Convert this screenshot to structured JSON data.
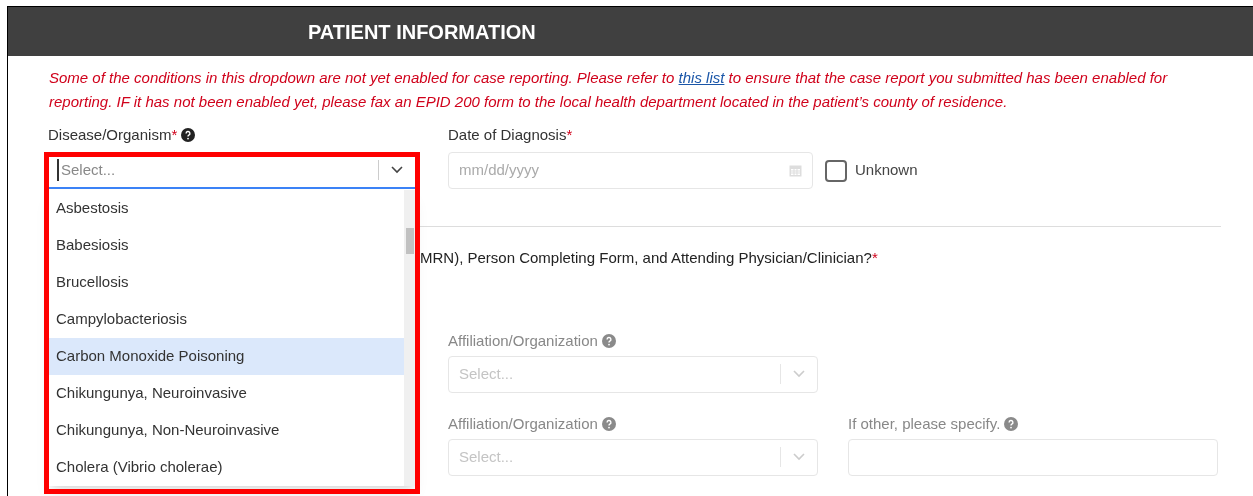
{
  "header": {
    "title": "PATIENT INFORMATION"
  },
  "notice": {
    "before": "Some of the conditions in this dropdown are not yet enabled for case reporting. Please refer to",
    "link": "this list",
    "after": "to ensure that the case report you submitted has been enabled for reporting. IF it has not been enabled yet, please fax an EPID 200 form to the local health department located in the patient’s county of residence."
  },
  "disease": {
    "label": "Disease/Organism",
    "required": "*",
    "placeholder": "Select...",
    "options": [
      {
        "label": "Asbestosis",
        "selected": false
      },
      {
        "label": "Babesiosis",
        "selected": false
      },
      {
        "label": "Brucellosis",
        "selected": false
      },
      {
        "label": "Campylobacteriosis",
        "selected": false
      },
      {
        "label": "Carbon Monoxide Poisoning",
        "selected": true
      },
      {
        "label": "Chikungunya, Neuroinvasive",
        "selected": false
      },
      {
        "label": "Chikungunya, Non-Neuroinvasive",
        "selected": false
      },
      {
        "label": "Cholera (Vibrio cholerae)",
        "selected": false
      }
    ]
  },
  "diagnosis_date": {
    "label": "Date of Diagnosis",
    "required": "*",
    "placeholder": "mm/dd/yyyy",
    "unknown": {
      "label": "Unknown",
      "checked": false
    }
  },
  "question": {
    "text": "MRN), Person Completing Form, and Attending Physician/Clinician?",
    "required": "*"
  },
  "rows": [
    {
      "affiliation": {
        "label": "Affiliation/Organization",
        "placeholder": "Select..."
      }
    },
    {
      "affiliation": {
        "label": "Affiliation/Organization",
        "placeholder": "Select..."
      },
      "other": {
        "label": "If other, please specify."
      }
    }
  ]
}
